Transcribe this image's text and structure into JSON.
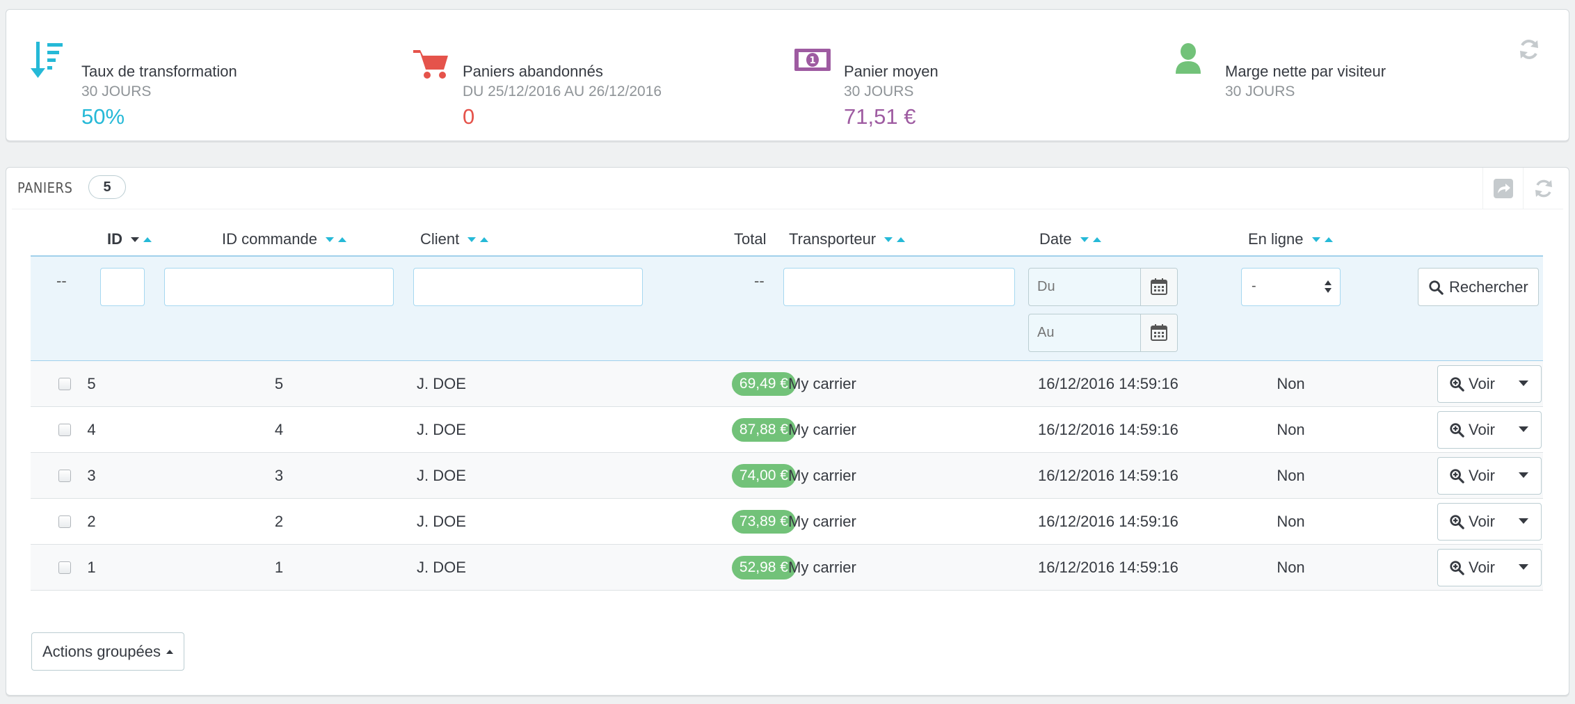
{
  "kpis": [
    {
      "title": "Taux de transformation",
      "subtitle": "30 JOURS",
      "value": "50%",
      "color": "#25b9d7",
      "icon": "sort-amount-desc-icon"
    },
    {
      "title": "Paniers abandonnés",
      "subtitle": "DU 25/12/2016 AU 26/12/2016",
      "value": "0",
      "color": "#e5534b",
      "icon": "shopping-cart-icon"
    },
    {
      "title": "Panier moyen",
      "subtitle": "30 JOURS",
      "value": "71,51 €",
      "color": "#9e5ba1",
      "icon": "money-icon"
    },
    {
      "title": "Marge nette par visiteur",
      "subtitle": "30 JOURS",
      "value": "",
      "color": "#72c279",
      "icon": "user-icon"
    }
  ],
  "panel": {
    "title": "PANIERS",
    "count": "5"
  },
  "columns": {
    "id": "ID",
    "order_id": "ID commande",
    "client": "Client",
    "total": "Total",
    "carrier": "Transporteur",
    "date": "Date",
    "online": "En ligne"
  },
  "filters": {
    "dash_left": "--",
    "dash_total": "--",
    "date_from_placeholder": "Du",
    "date_to_placeholder": "Au",
    "online_selected": "-",
    "search_label": "Rechercher"
  },
  "rows": [
    {
      "id": "5",
      "order_id": "5",
      "client": "J. DOE",
      "total": "69,49 €",
      "carrier": "My carrier",
      "date": "16/12/2016 14:59:16",
      "online": "Non",
      "action": "Voir"
    },
    {
      "id": "4",
      "order_id": "4",
      "client": "J. DOE",
      "total": "87,88 €",
      "carrier": "My carrier",
      "date": "16/12/2016 14:59:16",
      "online": "Non",
      "action": "Voir"
    },
    {
      "id": "3",
      "order_id": "3",
      "client": "J. DOE",
      "total": "74,00 €",
      "carrier": "My carrier",
      "date": "16/12/2016 14:59:16",
      "online": "Non",
      "action": "Voir"
    },
    {
      "id": "2",
      "order_id": "2",
      "client": "J. DOE",
      "total": "73,89 €",
      "carrier": "My carrier",
      "date": "16/12/2016 14:59:16",
      "online": "Non",
      "action": "Voir"
    },
    {
      "id": "1",
      "order_id": "1",
      "client": "J. DOE",
      "total": "52,98 €",
      "carrier": "My carrier",
      "date": "16/12/2016 14:59:16",
      "online": "Non",
      "action": "Voir"
    }
  ],
  "bulk_actions_label": "Actions groupées",
  "colors": {
    "accent": "#25b9d7",
    "price_badge": "#72c279"
  }
}
